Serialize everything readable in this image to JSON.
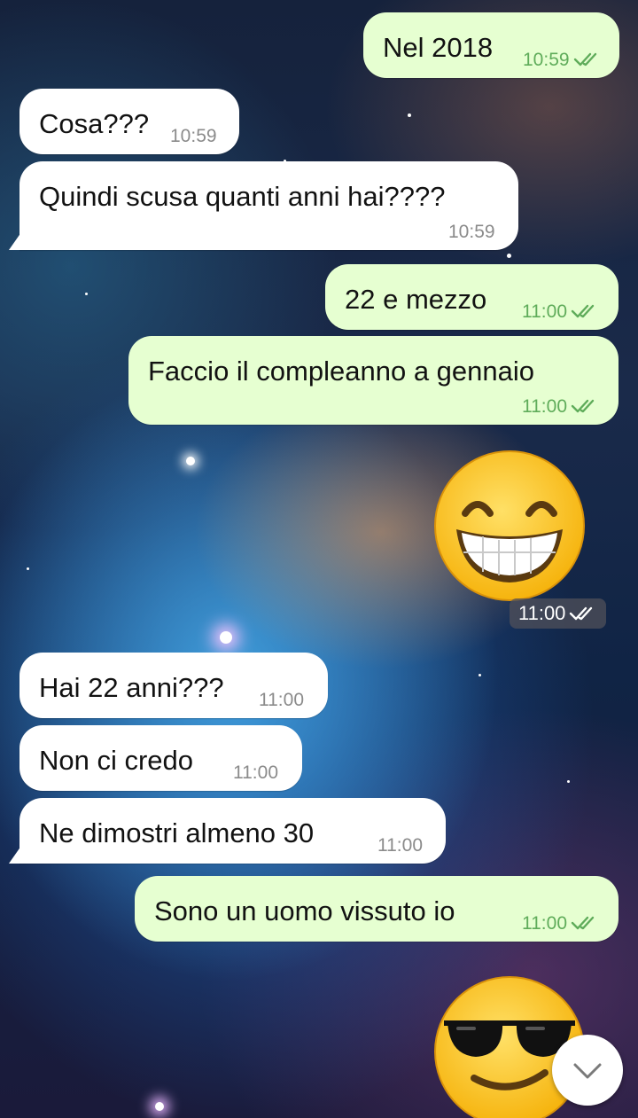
{
  "messages": [
    {
      "text": "Nel 2018",
      "time": "10:59"
    },
    {
      "text": "Cosa???",
      "time": "10:59"
    },
    {
      "text": "Quindi scusa quanti anni hai????",
      "time": "10:59"
    },
    {
      "text": "22 e mezzo",
      "time": "11:00"
    },
    {
      "text": "Faccio il compleanno a gennaio",
      "time": "11:00"
    },
    {
      "text": "Hai 22 anni???",
      "time": "11:00"
    },
    {
      "text": "Non ci credo",
      "time": "11:00"
    },
    {
      "text": "Ne dimostri almeno 30",
      "time": "11:00"
    },
    {
      "text": "Sono un uomo vissuto io",
      "time": "11:00"
    }
  ],
  "stickers": [
    {
      "emoji": "grinning-face-with-smiling-eyes",
      "time": "11:00"
    },
    {
      "emoji": "smiling-face-with-sunglasses"
    }
  ],
  "colors": {
    "incoming_bubble": "#ffffff",
    "outgoing_bubble": "#e6ffd1",
    "read_ticks": "#5fac5a",
    "timestamp_incoming": "#8b8b8b"
  },
  "icons": {
    "scroll_down": "chevron-down-icon",
    "read_receipt": "double-check-icon"
  }
}
